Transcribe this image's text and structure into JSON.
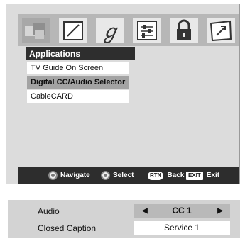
{
  "menu": {
    "title": "Applications",
    "items": [
      {
        "label": "TV Guide On Screen"
      },
      {
        "label": "Digital CC/Audio Selector"
      },
      {
        "label": "CableCARD"
      }
    ]
  },
  "tabs": [
    {
      "icon": "picture-tiles-icon"
    },
    {
      "icon": "screen-frame-icon"
    },
    {
      "icon": "treble-clef-icon"
    },
    {
      "icon": "settings-sliders-icon"
    },
    {
      "icon": "padlock-icon"
    },
    {
      "icon": "applications-upload-icon"
    }
  ],
  "legend": {
    "navigate": "Navigate",
    "select": "Select",
    "rtn_key": "RTN",
    "back": "Back",
    "exit_key": "EXIT",
    "exit": "Exit"
  },
  "panel": {
    "audio_label": "Audio",
    "audio_value": "CC 1",
    "cc_label": "Closed Caption",
    "cc_value": "Service 1"
  },
  "colors": {
    "selected_row": "#a3a3a3",
    "title_bar": "#2e2e2e",
    "legend_bar": "#2d2d2d"
  }
}
